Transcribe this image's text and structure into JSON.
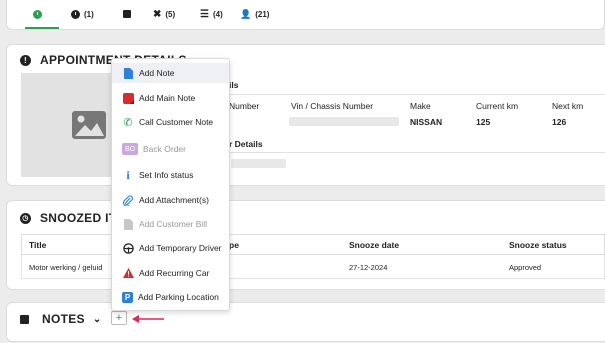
{
  "tabs": [
    {
      "icon": "alert-icon",
      "count": ""
    },
    {
      "icon": "clock-icon",
      "count": "(1)"
    },
    {
      "icon": "note-icon",
      "count": ""
    },
    {
      "icon": "tools-icon",
      "count": "(5)"
    },
    {
      "icon": "list-icon",
      "count": "(4)"
    },
    {
      "icon": "users-icon",
      "count": "(21)"
    }
  ],
  "appointment": {
    "title": "APPOINTMENT DETAILS",
    "section_suffix": "ils",
    "number_label": "Number",
    "vin_label": "Vin / Chassis Number",
    "make_label": "Make",
    "make_value": "NISSAN",
    "current_km_label": "Current km",
    "current_km_value": "125",
    "next_km_label": "Next km",
    "next_km_value": "126",
    "owner_suffix": "r Details"
  },
  "snoozed": {
    "title": "SNOOZED ITI",
    "col_title": "Title",
    "col_type_suffix": "pe",
    "col_date": "Snooze date",
    "col_status": "Snooze status",
    "row_title": "Motor werking / geluid",
    "row_date": "27-12-2024",
    "row_status": "Approved"
  },
  "notes": {
    "title": "NOTES",
    "add_symbol": "+"
  },
  "menu": [
    {
      "label": "Add Note",
      "icon": "document-icon",
      "disabled": false,
      "highlight": true
    },
    {
      "label": "Add Main Note",
      "icon": "main-note-icon",
      "disabled": false,
      "highlight": false
    },
    {
      "label": "Call Customer Note",
      "icon": "phone-icon",
      "disabled": false,
      "highlight": false
    },
    {
      "label": "Back Order",
      "icon": "bo-icon",
      "disabled": true,
      "highlight": false
    },
    {
      "label": "Set Info status",
      "icon": "info-icon",
      "disabled": false,
      "highlight": false
    },
    {
      "label": "Add Attachment(s)",
      "icon": "paperclip-icon",
      "disabled": false,
      "highlight": false
    },
    {
      "label": "Add Customer Bill",
      "icon": "bill-icon",
      "disabled": true,
      "highlight": false
    },
    {
      "label": "Add Temporary Driver",
      "icon": "steering-wheel-icon",
      "disabled": false,
      "highlight": false
    },
    {
      "label": "Add Recurring Car",
      "icon": "warning-icon",
      "disabled": false,
      "highlight": false
    },
    {
      "label": "Add Parking Location",
      "icon": "parking-icon",
      "disabled": false,
      "highlight": false
    }
  ],
  "menu_bo_badge": "BO",
  "colors": {
    "accent": "#2e9e4f",
    "arrow": "#e0245e"
  }
}
